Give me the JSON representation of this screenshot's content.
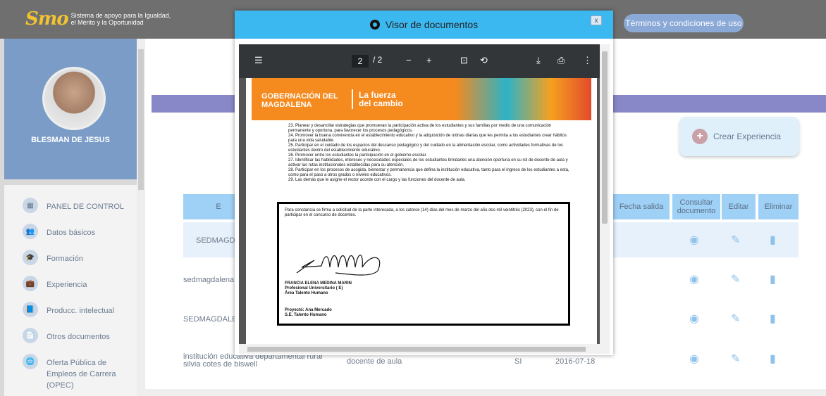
{
  "header": {
    "logo_mark": "Smo",
    "logo_text": "Sistema de apoyo para la Igualdad, el Mérito y la Oportunidad",
    "terms_button": "Términos y condiciones de uso"
  },
  "sidebar": {
    "profile_name": "BLESMAN DE JESUS",
    "items": [
      {
        "label": "PANEL DE CONTROL",
        "icon": "dashboard-icon",
        "glyph": "▦"
      },
      {
        "label": "Datos básicos",
        "icon": "users-icon",
        "glyph": "👥"
      },
      {
        "label": "Formación",
        "icon": "graduation-icon",
        "glyph": "🎓"
      },
      {
        "label": "Experiencia",
        "icon": "briefcase-icon",
        "glyph": "💼"
      },
      {
        "label": "Producc. intelectual",
        "icon": "book-icon",
        "glyph": "📘"
      },
      {
        "label": "Otros documentos",
        "icon": "file-icon",
        "glyph": "📄"
      },
      {
        "label": "Oferta Pública de Empleos de Carrera (OPEC)",
        "icon": "globe-icon",
        "glyph": "🌐"
      }
    ]
  },
  "main": {
    "crear_button": "Crear Experiencia",
    "columns": [
      "E",
      "Fecha salida",
      "Consultar documento",
      "Editar",
      "Eliminar"
    ],
    "rows": [
      {
        "entity": "SEDMAGDA",
        "cargo": "",
        "actual": "",
        "fecha_ingreso": ""
      },
      {
        "entity": "sedmagdalena",
        "cargo": "",
        "actual": "",
        "fecha_ingreso": ""
      },
      {
        "entity": "SEDMAGDALE",
        "cargo": "",
        "actual": "",
        "fecha_ingreso": ""
      },
      {
        "entity": "institución educativa departamental rural silvia cotes de biswell",
        "cargo": "docente de aula",
        "actual": "SI",
        "fecha_ingreso": "2016-07-18"
      }
    ]
  },
  "modal": {
    "title": "Visor de documentos",
    "close": "x",
    "viewer": {
      "page_current": "2",
      "page_total": "/ 2",
      "banner_gov": "GOBERNACIÓN DEL MAGDALENA",
      "banner_slogan": "La fuerza del cambio",
      "items": [
        "23. Planear y desarrollar estrategias que promuevan la participación activa de los estudiantes y sus familias por medio de una comunicación permanente y oportuna, para favorecer los procesos pedagógicos.",
        "24. Promover la buena convivencia en el establecimiento educativo y la adquisición de rutinas diarias que les permita a los estudiantes crear hábitos para una vida saludable.",
        "25. Participar en el cuidado de los espacios del descanso pedagógico y del cuidado en la alimentación escolar, como actividades formativas de los estudiantes dentro del establecimiento educativo.",
        "26. Promover entre los estudiantes la participación en el gobierno escolar.",
        "27. Identificar las habilidades, intereses y necesidades especiales de los estudiantes brindarles una atención oportuna en su rol de docente de aula y activar las rutas institucionales establecidas para su atención.",
        "28. Participar en los procesos de acogida, bienestar y permanencia que defina la institución educativa, tanto para el ingreso de los estudiantes a esta, como para el paso a otros grados o niveles educativos.",
        "29. Las demás que le asigne el rector acorde con el cargo y las funciones del docente de aula."
      ],
      "constancia": "Para constancia se firma a solicitud de la parte interesada, a los catorce (14) días del mes de marzo del año dos mil veintitrés (2023), con el fin de participar en el concurso de docentes.",
      "signer_name": "FRANCIA ELENA MEDINA MARIN",
      "signer_role": "Profesional Universitario ( E)",
      "signer_area": "Área Talento Humano",
      "proyecto": "Proyectó: Ana Mercado",
      "proyecto_area": "S.E. Talento Humano"
    }
  }
}
